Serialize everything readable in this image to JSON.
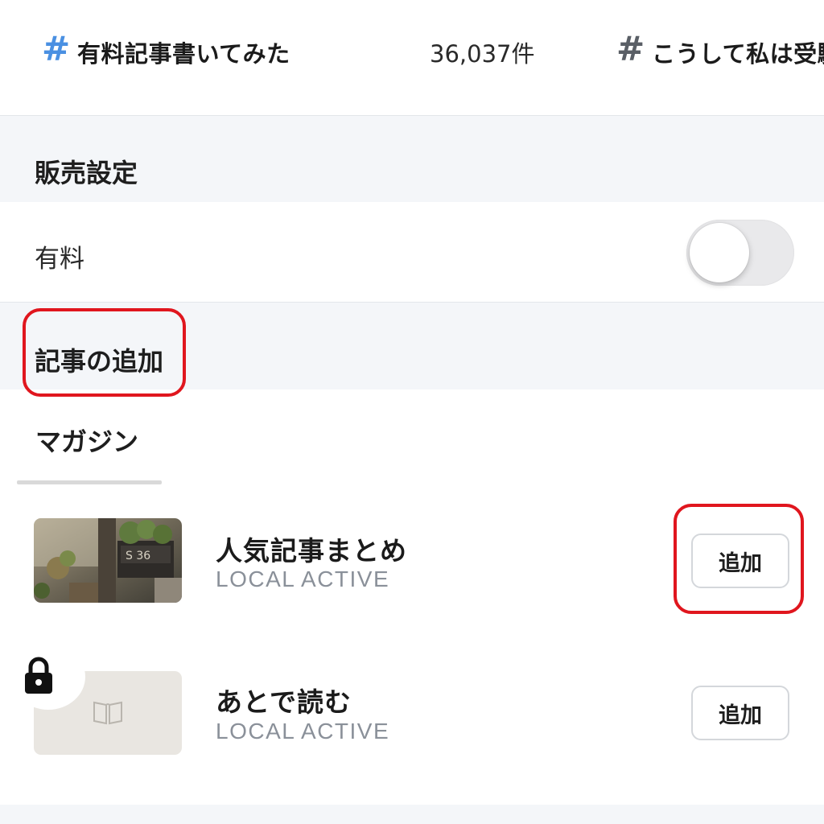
{
  "hashtags": [
    {
      "icon": "hash-icon",
      "name": "有料記事書いてみた",
      "count": "36,037件",
      "color": "#4a90e2"
    },
    {
      "icon": "hash-icon",
      "name": "こうして私は受験",
      "count": "",
      "color": "#5a5f66"
    }
  ],
  "sales_settings": {
    "title": "販売設定",
    "paid_label": "有料",
    "paid_enabled": false
  },
  "add_article": {
    "title": "記事の追加"
  },
  "tabs": [
    {
      "label": "マガジン",
      "active": true
    }
  ],
  "magazines": [
    {
      "title": "人気記事まとめ",
      "subtitle": "LOCAL ACTIVE",
      "button": "追加",
      "thumbnail": "photo-thumbnail",
      "locked": false
    },
    {
      "title": "あとで読む",
      "subtitle": "LOCAL ACTIVE",
      "button": "追加",
      "thumbnail": "book-icon",
      "locked": true
    }
  ],
  "colors": {
    "accent_hash": "#4a90e2",
    "highlight": "#e0161e",
    "section_bg": "#f4f6f9"
  }
}
